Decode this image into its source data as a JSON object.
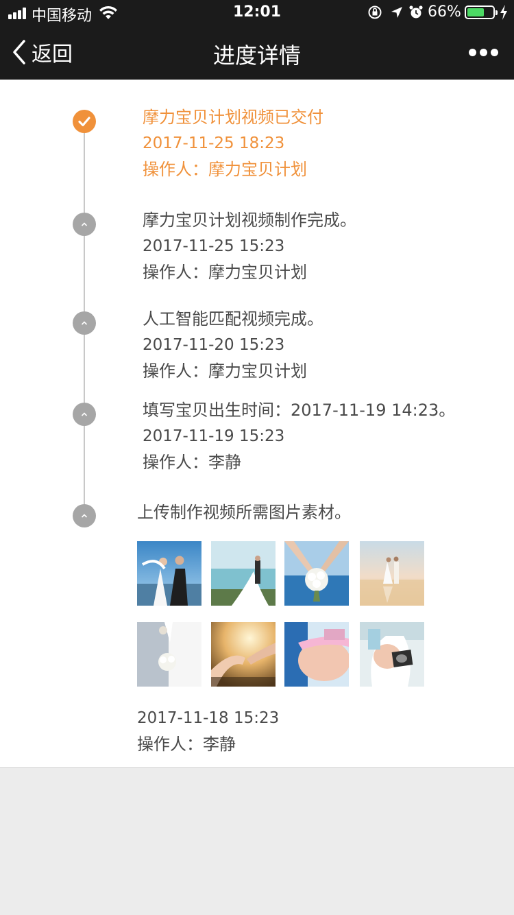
{
  "status_bar": {
    "carrier": "中国移动",
    "time": "12:01",
    "battery_percent": "66%",
    "battery_level": 0.66,
    "icons": [
      "signal-icon",
      "wifi-icon",
      "orientation-lock-icon",
      "location-icon",
      "alarm-icon",
      "battery-icon",
      "charging-icon"
    ]
  },
  "nav": {
    "back_label": "返回",
    "title": "进度详情",
    "more_icon": "more-icon"
  },
  "colors": {
    "accent": "#f0913a",
    "nav_bg": "#1b1b1b",
    "node_gray": "#a6a6a6",
    "text": "#4a4a4a"
  },
  "timeline": [
    {
      "title": "摩力宝贝计划视频已交付",
      "time": "2017-11-25 18:23",
      "operator": "操作人：摩力宝贝计划",
      "status": "done",
      "icon": "check-icon"
    },
    {
      "title": "摩力宝贝计划视频制作完成。",
      "time": "2017-11-25 15:23",
      "operator": "操作人：摩力宝贝计划",
      "icon": "chevron-up-icon"
    },
    {
      "title": "人工智能匹配视频完成。",
      "time": "2017-11-20 15:23",
      "operator": "操作人：摩力宝贝计划",
      "icon": "chevron-up-icon"
    },
    {
      "title": "填写宝贝出生时间：2017-11-19 14:23。",
      "time": "2017-11-19 15:23",
      "operator": "操作人：李静",
      "icon": "chevron-up-icon"
    },
    {
      "title": "上传制作视频所需图片素材。",
      "time": "2017-11-18 15:23",
      "operator": "操作人：李静",
      "icon": "chevron-up-icon",
      "photos": [
        "wedding-couple-photo",
        "beach-wedding-photo",
        "bridal-bouquet-photo",
        "sunset-beach-couple-photo",
        "wedding-bouquet-closeup-photo",
        "holding-hands-photo",
        "pregnant-belly-photo",
        "ultrasound-photo"
      ]
    }
  ]
}
